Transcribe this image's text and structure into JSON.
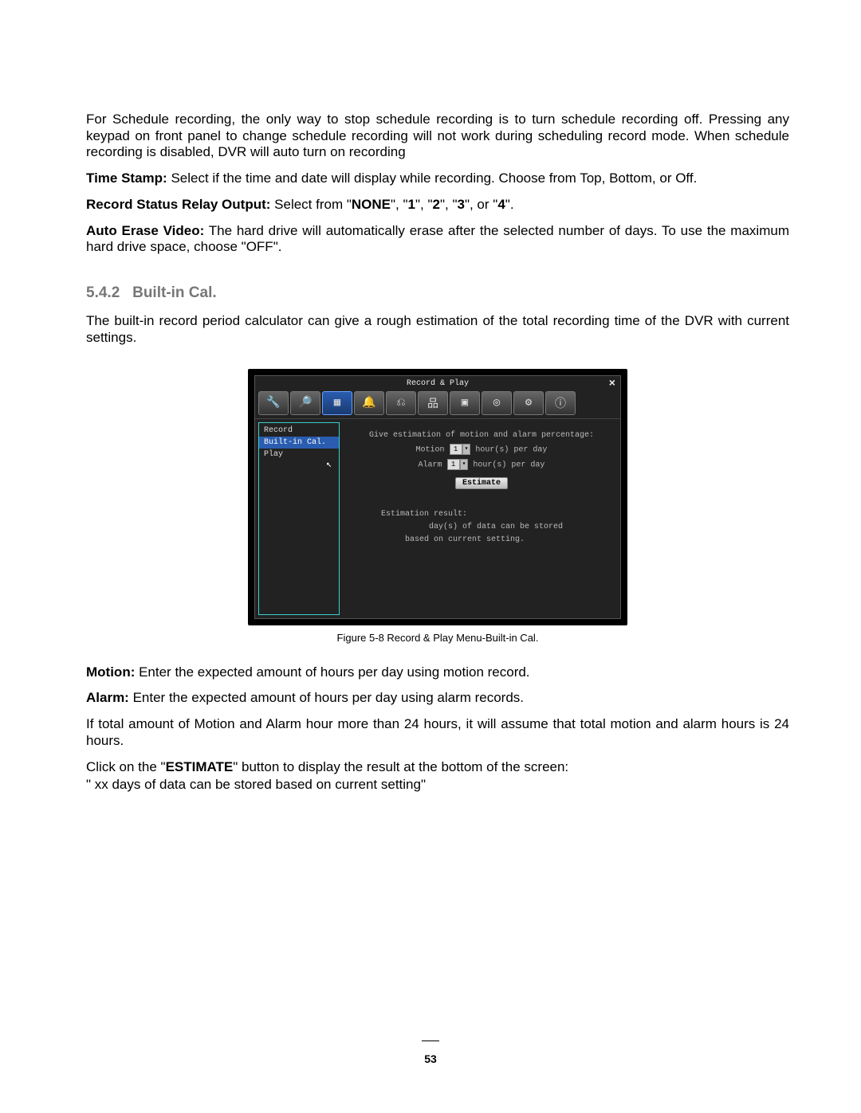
{
  "paragraphs": {
    "p1": "For Schedule recording, the only way to stop schedule recording is to turn schedule recording off. Pressing any keypad on front panel to change schedule recording will not work during scheduling record mode. When schedule recording is disabled, DVR will auto turn on recording",
    "time_stamp_label": "Time Stamp:",
    "time_stamp_text": " Select if the time and date will display while recording. Choose from Top, Bottom, or Off.",
    "relay_label": "Record Status Relay Output:",
    "relay_text_1": " Select from \"",
    "relay_none": "NONE",
    "relay_text_2": "\", \"",
    "relay_1": "1",
    "relay_text_3": "\", \"",
    "relay_2": "2",
    "relay_text_4": "\", \"",
    "relay_3": "3",
    "relay_text_5": "\", or \"",
    "relay_4": "4",
    "relay_text_6": "\".",
    "auto_erase_label": "Auto Erase Video:",
    "auto_erase_text": " The hard drive will automatically erase after the selected number of days. To use the maximum hard drive space, choose \"OFF\"."
  },
  "section": {
    "num": "5.4.2",
    "title": "Built-in Cal."
  },
  "section_intro": "The built-in record period calculator can give a rough estimation of the total recording time of the DVR with current settings.",
  "screenshot": {
    "title": "Record & Play",
    "close": "×",
    "toolbar_icons": [
      "🔧",
      "🔎",
      "▦",
      "🔔",
      "⎌",
      "品",
      "▣",
      "◎",
      "⚙",
      "ⓘ"
    ],
    "active_toolbar_index": 2,
    "sidebar": [
      {
        "label": "Record",
        "selected": false
      },
      {
        "label": "Built-in Cal.",
        "selected": true
      },
      {
        "label": "Play",
        "selected": false
      }
    ],
    "content": {
      "heading": "Give estimation of motion and alarm percentage:",
      "motion_label": "Motion",
      "motion_value": "1",
      "motion_unit": "hour(s) per day",
      "alarm_label": "Alarm",
      "alarm_value": "1",
      "alarm_unit": "hour(s) per day",
      "estimate_btn": "Estimate",
      "result_heading": "Estimation result:",
      "result_line2": "day(s) of data can be stored",
      "result_line3": "based on current setting."
    }
  },
  "figure_caption": "Figure 5-8  Record & Play Menu-Built-in Cal.",
  "below": {
    "motion_label": "Motion:",
    "motion_text": " Enter the expected amount of hours per day using motion record.",
    "alarm_label": "Alarm:",
    "alarm_text": " Enter the expected amount of hours per day using alarm records.",
    "overflow": "If total amount of Motion and Alarm hour more than 24 hours, it will assume that total motion and alarm hours is 24 hours.",
    "click_pre": "Click on the \"",
    "estimate_label": "ESTIMATE",
    "click_post": "\" button to display the result at the bottom of the screen:",
    "quote_line": "\" xx days of data can be stored based on current setting\""
  },
  "page_number": "53"
}
